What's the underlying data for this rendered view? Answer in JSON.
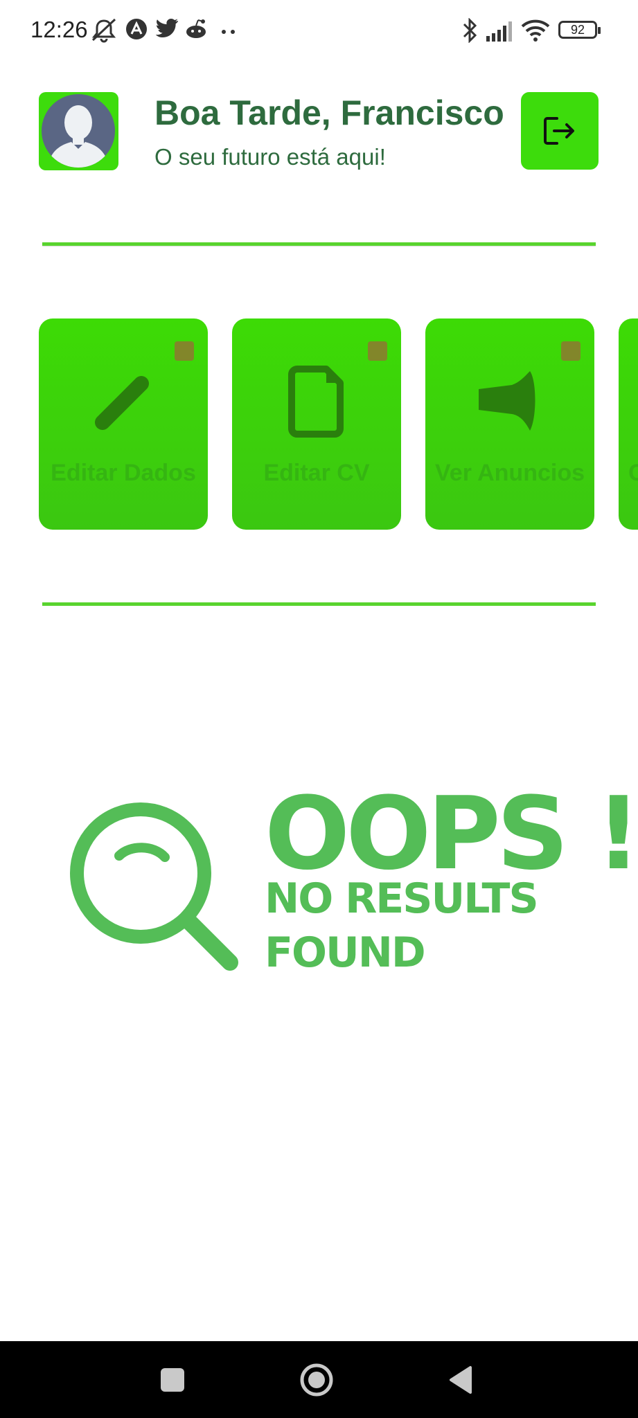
{
  "status_bar": {
    "time": "12:26",
    "battery": "92",
    "icons": [
      "mute-icon",
      "app-a-icon",
      "twitter-icon",
      "reddit-icon",
      "more-dots-icon",
      "bluetooth-icon",
      "signal-icon",
      "wifi-icon",
      "battery-icon"
    ]
  },
  "header": {
    "greeting": "Boa Tarde, Francisco",
    "tagline": "O seu futuro está aqui!",
    "avatar_icon": "user-avatar-icon",
    "logout_icon": "logout-icon"
  },
  "actions": [
    {
      "label": "Editar Dados",
      "icon": "pencil-icon"
    },
    {
      "label": "Editar CV",
      "icon": "document-icon"
    },
    {
      "label": "Ver Anuncios",
      "icon": "megaphone-icon"
    },
    {
      "label": "C",
      "icon": ""
    }
  ],
  "empty_state": {
    "title": "OOPS !",
    "line1": "NO RESULTS",
    "line2": "FOUND",
    "icon": "magnifier-icon"
  },
  "colors": {
    "primary_green": "#3ddc0c",
    "text_green": "#2e6b3e",
    "empty_state_green": "#54bd57"
  },
  "nav": [
    "recents-button",
    "home-button",
    "back-button"
  ]
}
